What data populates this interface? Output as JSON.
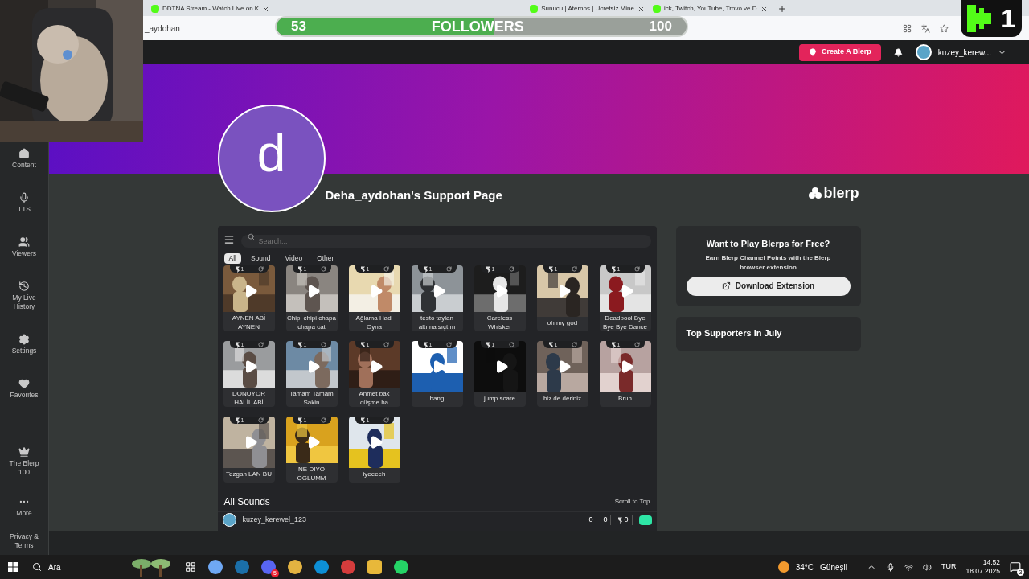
{
  "browser": {
    "tabs": [
      {
        "title": "DDTNA Stream - Watch Live on K"
      },
      {
        "title": "Sunucu | Aternos | Ücretsiz Mine"
      },
      {
        "title": "ick, Twitch, YouTube, Trovo ve D"
      }
    ],
    "address": "_aydohan"
  },
  "overlay": {
    "followers": {
      "current": "53",
      "label": "FOLLOWERS",
      "goal": "100",
      "level": 0.53
    },
    "counter": "1"
  },
  "header": {
    "create_button": "Create A Blerp",
    "username": "kuzey_kerew..."
  },
  "sidebar": [
    {
      "label": "Content"
    },
    {
      "label": "TTS"
    },
    {
      "label": "Viewers"
    },
    {
      "label": "My Live History"
    },
    {
      "label": "Settings"
    },
    {
      "label": "Favorites"
    },
    {
      "label": "The Blerp 100"
    },
    {
      "label": "More"
    },
    {
      "label": "Privacy & Terms"
    }
  ],
  "profile": {
    "avatar_letter": "d",
    "title": "Deha_aydohan's Support Page",
    "brand": "blerp"
  },
  "search": {
    "placeholder": "Search..."
  },
  "filters": [
    {
      "label": "All",
      "selected": true
    },
    {
      "label": "Sound",
      "selected": false
    },
    {
      "label": "Video",
      "selected": false
    },
    {
      "label": "Other",
      "selected": false
    }
  ],
  "tiles": [
    {
      "title": "AYNEN ABİ AYNEN",
      "cost": "1"
    },
    {
      "title": "Chipi chipi chapa chapa cat",
      "cost": "1"
    },
    {
      "title": "Ağlama Hadi Oyna",
      "cost": "1"
    },
    {
      "title": "testo taylan altıma sıçtım",
      "cost": "1"
    },
    {
      "title": "Careless Whisker",
      "cost": "1"
    },
    {
      "title": "oh my god",
      "cost": "1"
    },
    {
      "title": "Deadpool Bye Bye Bye Dance",
      "cost": "1"
    },
    {
      "title": "DONUYOR HALİL ABİ",
      "cost": "1"
    },
    {
      "title": "Tamam Tamam Sakin",
      "cost": "1"
    },
    {
      "title": "Ahmet bak düşme ha",
      "cost": "1"
    },
    {
      "title": "bang",
      "cost": "1"
    },
    {
      "title": "jump scare",
      "cost": "1"
    },
    {
      "title": "biz de deriniz",
      "cost": "1"
    },
    {
      "title": "Bruh",
      "cost": "1"
    },
    {
      "title": "Tezgah LAN BU",
      "cost": "1"
    },
    {
      "title": "NE DİYO OGLUMM",
      "cost": "1"
    },
    {
      "title": "iyeeeeh",
      "cost": "1"
    }
  ],
  "all_sounds": {
    "title": "All Sounds",
    "scroll": "Scroll to Top",
    "entry": {
      "user": "kuzey_kerewel_123",
      "counts": [
        "0",
        "0",
        "0"
      ]
    }
  },
  "promo": {
    "title": "Want to Play Blerps for Free?",
    "text": "Earn Blerp Channel Points with the Blerp browser extension",
    "button": "Download Extension"
  },
  "supporters": {
    "title": "Top Supporters in July"
  },
  "taskbar": {
    "search": "Ara",
    "app_badge": "5",
    "temp": "34°C",
    "weather": "Güneşli",
    "lang": "TUR",
    "time": "14:52",
    "date": "18.07.2025",
    "notifications": "3"
  }
}
